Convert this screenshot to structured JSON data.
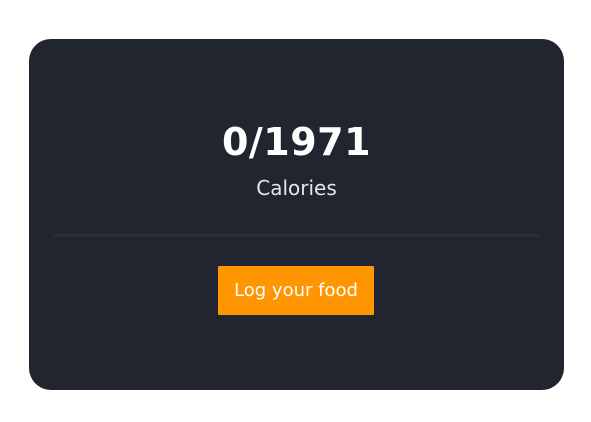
{
  "calories": {
    "consumed": "0",
    "separator": "/",
    "goal": "1971",
    "display": "0/1971",
    "label": "Calories"
  },
  "actions": {
    "log_food_label": "Log your food"
  },
  "colors": {
    "card_background": "#21252f",
    "accent": "#ff9500",
    "text": "#ffffff"
  }
}
